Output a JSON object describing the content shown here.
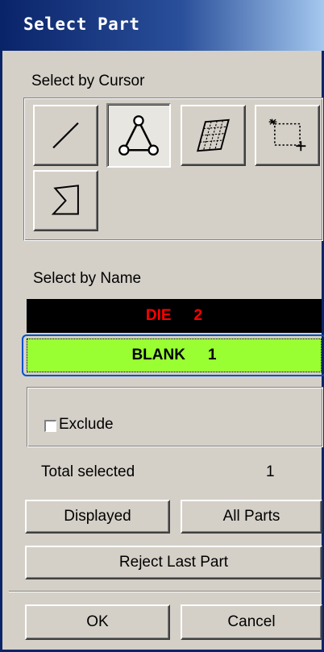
{
  "window": {
    "title": "Select Part"
  },
  "select_by_cursor": {
    "label": "Select by Cursor",
    "tools": [
      {
        "icon": "line-select-icon"
      },
      {
        "icon": "triangle-node-select-icon",
        "active": true
      },
      {
        "icon": "surface-mesh-select-icon"
      },
      {
        "icon": "box-select-icon"
      },
      {
        "icon": "polygon-select-icon"
      }
    ]
  },
  "select_by_name": {
    "label": "Select by Name",
    "parts": [
      {
        "name": "DIE",
        "id": "2",
        "bg": "#000000",
        "fg": "#ff0000"
      },
      {
        "name": "BLANK",
        "id": "1",
        "bg": "#99ff33",
        "fg": "#000000",
        "selected": true
      }
    ]
  },
  "exclude": {
    "label": "Exclude",
    "checked": false
  },
  "total": {
    "label": "Total selected",
    "value": "1"
  },
  "buttons": {
    "displayed": "Displayed",
    "all_parts": "All Parts",
    "reject_last": "Reject Last Part",
    "ok": "OK",
    "cancel": "Cancel"
  },
  "colors": {
    "focus_ring": "#0050c8",
    "title_bar": "#0a246a"
  }
}
